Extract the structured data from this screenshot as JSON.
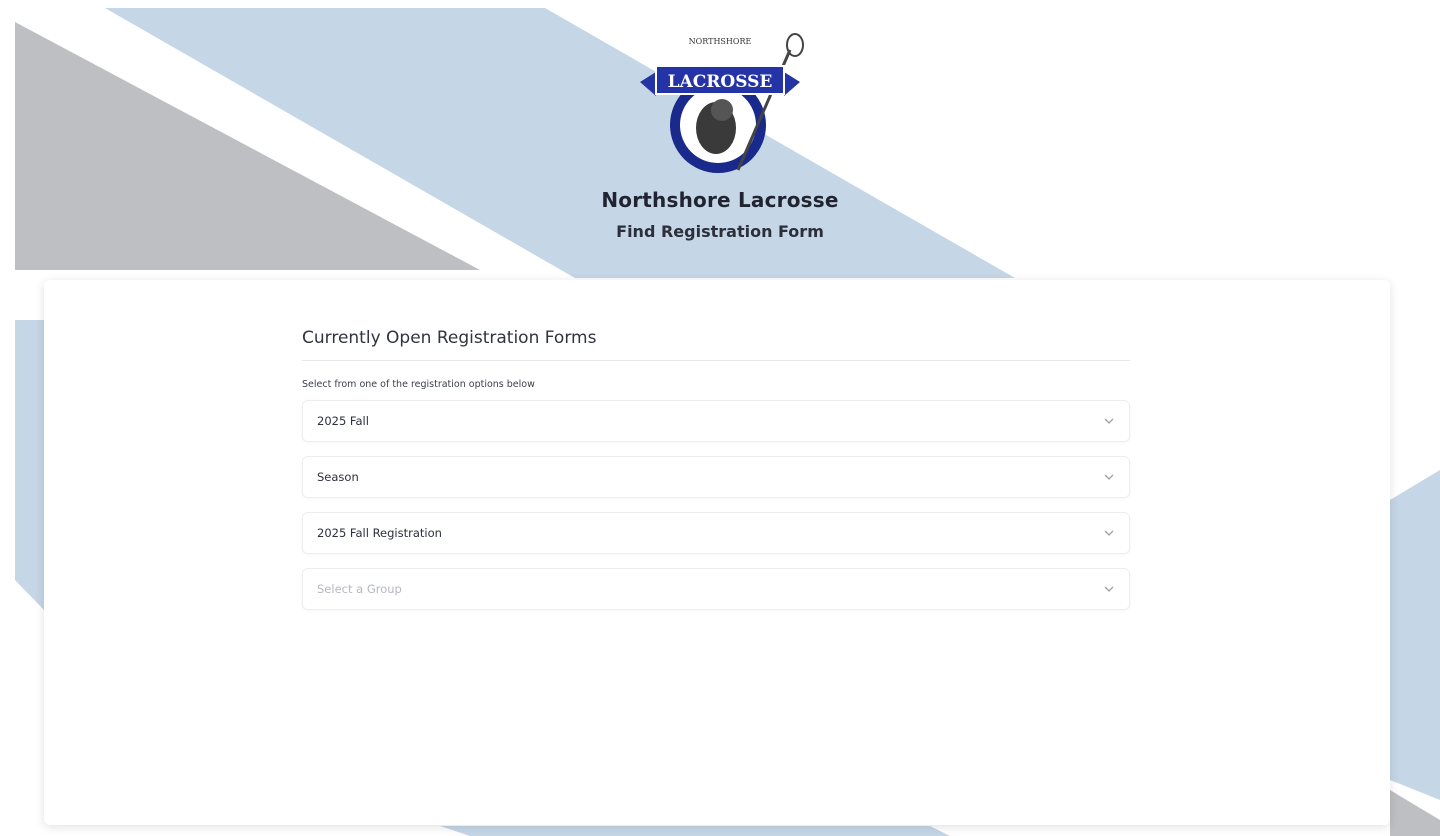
{
  "header": {
    "org_name": "Northshore Lacrosse",
    "page_subtitle": "Find Registration Form",
    "logo": {
      "top_text": "NORTHSHORE",
      "banner_text": "LACROSSE",
      "colors": {
        "navy": "#1a2a8c",
        "banner": "#2433a6"
      }
    }
  },
  "form": {
    "section_title": "Currently Open Registration Forms",
    "instruction": "Select from one of the registration options below",
    "selects": [
      {
        "value": "2025 Fall",
        "placeholder": false
      },
      {
        "value": "Season",
        "placeholder": false
      },
      {
        "value": "2025 Fall Registration",
        "placeholder": false
      },
      {
        "value": "Select a Group",
        "placeholder": true
      }
    ]
  },
  "colors": {
    "stripe_blue": "#c5d6e6",
    "stripe_gray": "#bdbfc2",
    "card_bg": "#ffffff"
  }
}
